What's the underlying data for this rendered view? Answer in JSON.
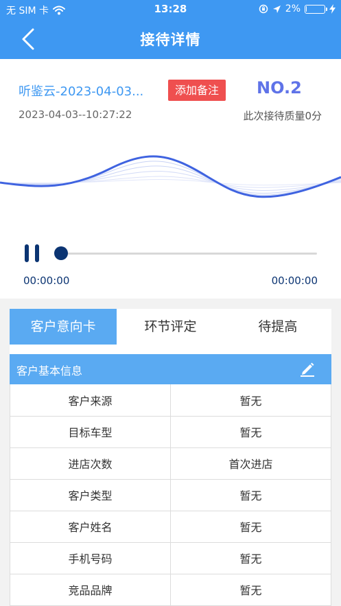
{
  "status_bar": {
    "carrier": "无 SIM 卡",
    "time": "13:28",
    "battery": "2%",
    "battery_level": 0.02
  },
  "nav": {
    "title": "接待详情",
    "back_icon": "chevron-left-icon"
  },
  "recording": {
    "name": "听鉴云-2023-04-03...",
    "add_note_label": "添加备注",
    "number": "NO.2",
    "datetime": "2023-04-03--10:27:22",
    "quality_text": "此次接待质量0分"
  },
  "player": {
    "current_time": "00:00:00",
    "total_time": "00:00:00",
    "progress": 0
  },
  "tabs": [
    {
      "label": "客户意向卡"
    },
    {
      "label": "环节评定"
    },
    {
      "label": "待提高"
    }
  ],
  "section": {
    "title": "客户基本信息",
    "edit_icon": "edit-icon"
  },
  "info_rows": [
    {
      "label": "客户来源",
      "value": "暂无"
    },
    {
      "label": "目标车型",
      "value": "暂无"
    },
    {
      "label": "进店次数",
      "value": "首次进店"
    },
    {
      "label": "客户类型",
      "value": "暂无"
    },
    {
      "label": "客户姓名",
      "value": "暂无"
    },
    {
      "label": "手机号码",
      "value": "暂无"
    },
    {
      "label": "竞品品牌",
      "value": "暂无"
    }
  ],
  "colors": {
    "header": "#3e98f2",
    "tab_active": "#5aaaf2",
    "note_button": "#ef4f4f",
    "number": "#5f73e8",
    "player": "#0b3472",
    "wave": "#3f63e0"
  }
}
